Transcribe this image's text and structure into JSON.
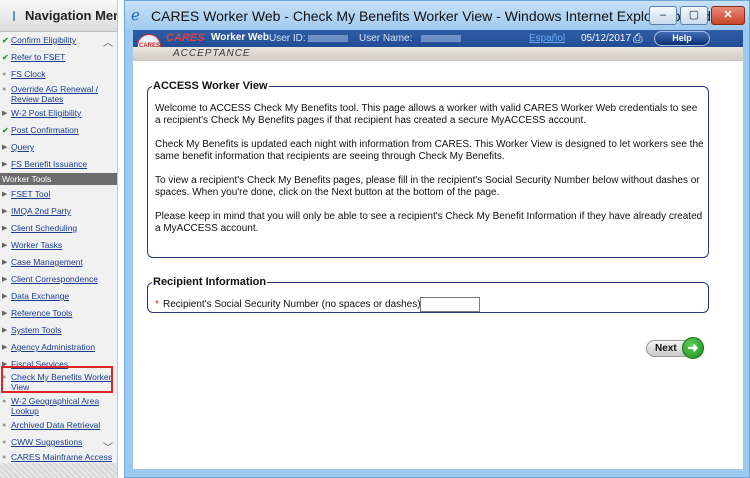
{
  "nav": {
    "title": "Navigation Menu",
    "items": [
      {
        "label": "Confirm Eligibility",
        "icon": "check-icon"
      },
      {
        "label": "Refer to FSET",
        "icon": "check-icon"
      },
      {
        "label": "FS Clock",
        "icon": "bullet-icon"
      },
      {
        "label": "Override AG Renewal /",
        "label2": "Review Dates",
        "icon": "bullet-icon"
      },
      {
        "label": "W-2 Post Eligibility",
        "icon": "expand-arrow-icon"
      },
      {
        "label": "Post Confirmation",
        "icon": "check-icon"
      },
      {
        "label": "Query",
        "icon": "expand-arrow-icon"
      },
      {
        "label": "FS Benefit Issuance",
        "icon": "expand-arrow-icon"
      },
      {
        "label": "FSET Tool",
        "icon": "expand-arrow-icon"
      },
      {
        "label": "IMQA 2nd Party",
        "icon": "expand-arrow-icon"
      },
      {
        "label": "Client Scheduling",
        "icon": "expand-arrow-icon"
      },
      {
        "label": "Worker Tasks",
        "icon": "expand-arrow-icon"
      },
      {
        "label": "Case Management",
        "icon": "expand-arrow-icon"
      },
      {
        "label": "Client Correspondence",
        "icon": "expand-arrow-icon"
      },
      {
        "label": "Data Exchange",
        "icon": "expand-arrow-icon"
      },
      {
        "label": "Reference Tools",
        "icon": "expand-arrow-icon"
      },
      {
        "label": "System Tools",
        "icon": "expand-arrow-icon"
      },
      {
        "label": "Agency Administration",
        "icon": "expand-arrow-icon"
      },
      {
        "label": "Fiscal Services",
        "icon": "expand-arrow-icon"
      },
      {
        "label": "Check My Benefits Worker",
        "label2": "View",
        "icon": "bullet-icon"
      },
      {
        "label": "W-2 Geographical Area",
        "label2": "Lookup",
        "icon": "bullet-icon"
      },
      {
        "label": "Archived Data Retrieval",
        "icon": "bullet-icon"
      },
      {
        "label": "CWW Suggestions",
        "icon": "bullet-icon"
      },
      {
        "label": "CARES Mainframe Access",
        "icon": "bullet-icon"
      }
    ],
    "section_label": "Worker Tools"
  },
  "window": {
    "title": "CARES Worker Web - Check My Benefits Worker View - Windows Internet Explorer provided by D...",
    "min_label": "–",
    "max_label": "▢",
    "close_label": "✕"
  },
  "app_header": {
    "logo_text": "CARES",
    "name_cares": "CARES",
    "name_rest": "Worker Web",
    "user_id_label": "User ID:",
    "user_name_label": "User Name:",
    "spanish_link": "Español",
    "date": "05/12/2017",
    "help_label": "Help",
    "environment": "ACCEPTANCE"
  },
  "access_section": {
    "legend": "ACCESS Worker View",
    "paragraphs": [
      "Welcome to ACCESS Check My Benefits tool. This page allows a worker with valid CARES Worker Web credentials to see a recipient's Check My Benefits pages if that recipient has created a secure MyACCESS account.",
      "Check My Benefits is updated each night with information from CARES. This Worker View is designed to let workers see the same benefit information that recipients are seeing through Check My Benefits.",
      "To view a recipient's Check My Benefits pages, please fill in the recipient's Social Security Number below without dashes or spaces. When you're done, click on the Next button at the bottom of the page.",
      "Please keep in mind that you will only be able to see a recipient's Check My Benefit Information if they have already created a MyACCESS account."
    ]
  },
  "recipient_section": {
    "legend": "Recipient Information",
    "required_marker": "*",
    "ssn_label": "Recipient's Social Security Number (no spaces or dashes) :",
    "ssn_value": ""
  },
  "next_button": {
    "label": "Next"
  }
}
